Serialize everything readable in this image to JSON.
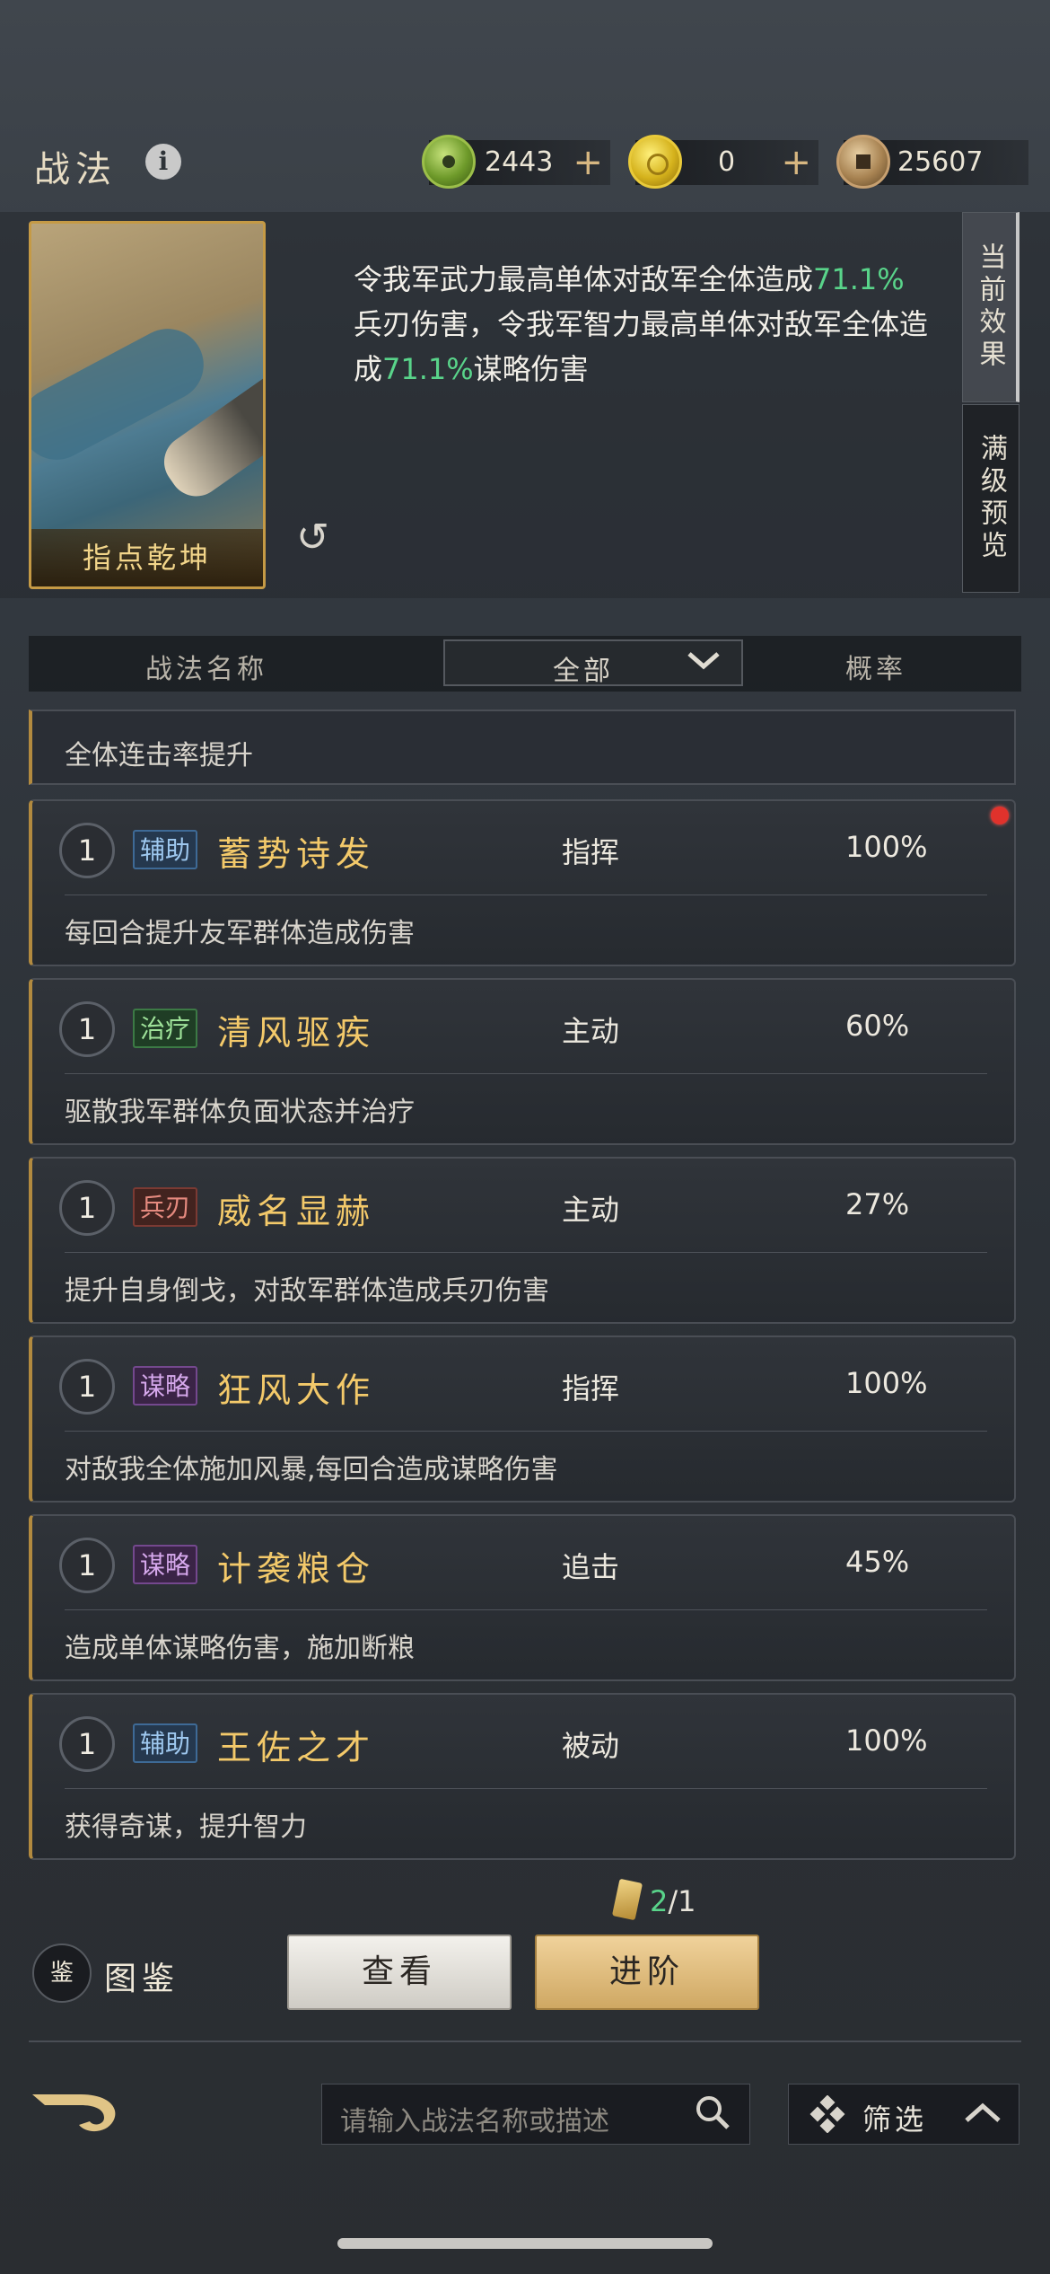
{
  "header": {
    "title": "战法",
    "resources": [
      {
        "icon": "jade-coin-icon",
        "value": "2443",
        "plus": "+"
      },
      {
        "icon": "gold-coin-icon",
        "value": "0",
        "plus": "+"
      },
      {
        "icon": "copper-coin-icon",
        "value": "25607"
      }
    ]
  },
  "detail": {
    "card_name": "指点乾坤",
    "description": {
      "p1": "令我军武力最高单体对敌军全体造成",
      "v1": "71.1%",
      "p2": "兵刃伤害，令我军智力最高单体对敌军全体造成",
      "v2": "71.1%",
      "p3": "谋略伤害"
    },
    "tabs": {
      "current": "当前效果",
      "preview": "满级预览"
    }
  },
  "list_header": {
    "name": "战法名称",
    "filter": "全部",
    "rate": "概率"
  },
  "partial_row": {
    "subtitle": "全体连击率提升"
  },
  "skills": [
    {
      "level": "1",
      "tag": "辅助",
      "tag_kind": "fuzhu",
      "name": "蓄势诗发",
      "type": "指挥",
      "rate": "100%",
      "desc": "每回合提升友军群体造成伤害",
      "badge": true
    },
    {
      "level": "1",
      "tag": "治疗",
      "tag_kind": "zhiliao",
      "name": "清风驱疾",
      "type": "主动",
      "rate": "60%",
      "desc": "驱散我军群体负面状态并治疗"
    },
    {
      "level": "1",
      "tag": "兵刃",
      "tag_kind": "bingren",
      "name": "威名显赫",
      "type": "主动",
      "rate": "27%",
      "desc": "提升自身倒戈，对敌军群体造成兵刃伤害"
    },
    {
      "level": "1",
      "tag": "谋略",
      "tag_kind": "moulue",
      "name": "狂风大作",
      "type": "指挥",
      "rate": "100%",
      "desc": "对敌我全体施加风暴,每回合造成谋略伤害"
    },
    {
      "level": "1",
      "tag": "谋略",
      "tag_kind": "moulue",
      "name": "计袭粮仓",
      "type": "追击",
      "rate": "45%",
      "desc": "造成单体谋略伤害，施加断粮"
    },
    {
      "level": "1",
      "tag": "辅助",
      "tag_kind": "fuzhu",
      "name": "王佐之才",
      "type": "被动",
      "rate": "100%",
      "desc": "获得奇谋，提升智力"
    }
  ],
  "bottom": {
    "count_current": "2",
    "count_total": "/1",
    "album_icon_text": "鉴",
    "album_label": "图鉴",
    "view_button": "查看",
    "advance_button": "进阶",
    "search_placeholder": "请输入战法名称或描述",
    "filter_label": "筛选"
  }
}
